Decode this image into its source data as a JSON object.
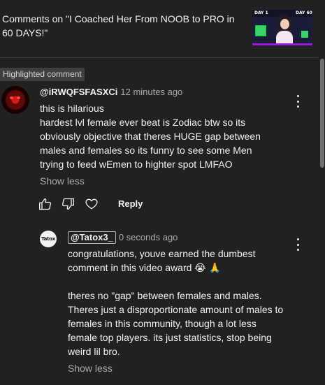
{
  "header": {
    "title": "Comments on \"I Coached Her From NOOB to PRO in 60 DAYS!\"",
    "thumbnail": {
      "label_left": "DAY 1",
      "label_right": "DAY 60"
    }
  },
  "badge": "Highlighted comment",
  "comment": {
    "author": "@iRWQFSFASXCi",
    "time": "12 minutes ago",
    "body": "this is hilarious\nhardest lvl female ever beat is Zodiac btw so its obviously objective that theres HUGE gap between males and females so its funny to see some Men trying to feed wEmen to highter spot LMFAO",
    "show_less": "Show less",
    "actions": {
      "like_icon": "thumbs-up-icon",
      "dislike_icon": "thumbs-down-icon",
      "heart_icon": "heart-icon",
      "reply": "Reply"
    }
  },
  "reply": {
    "author": "@Tatox3_",
    "avatar_text": "Tatox",
    "time": "0 seconds ago",
    "body": "congratulations, youve earned the dumbest comment in this video award 😭 🙏\n\ntheres no \"gap\" between females and males. Theres just a disproportionate amount of males to females in this community, though a lot less female top players. its just statistics, stop being weird lil bro.",
    "show_less": "Show less"
  },
  "colors": {
    "background": "#212121",
    "text": "#f1f1f1",
    "muted": "#aaaaaa",
    "badge_bg": "#3f3f3f"
  }
}
